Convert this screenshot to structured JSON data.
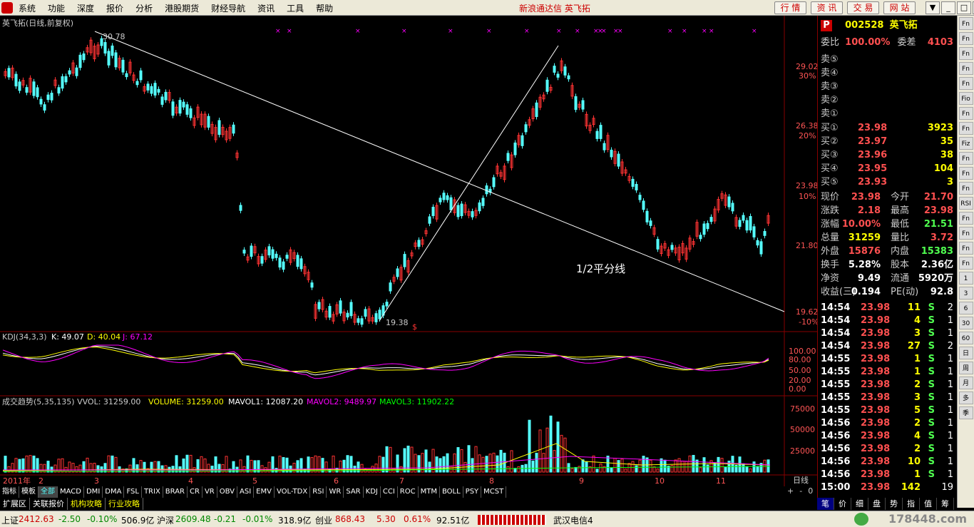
{
  "menubar": {
    "items": [
      "系统",
      "功能",
      "深度",
      "报价",
      "分析",
      "港股期货",
      "财经导航",
      "资讯",
      "工具",
      "帮助"
    ],
    "title": "新浪通达信  英飞拓",
    "buttons": [
      "行 情",
      "资 讯",
      "交 易",
      "网 站"
    ],
    "window_buttons": [
      "▼",
      "_",
      "□",
      "×"
    ]
  },
  "main_chart": {
    "title": "英飞拓(日线,前复权)",
    "high_label": "30.78",
    "low_label": "19.38",
    "annotation": "1/2平分线",
    "price_ticks": [
      "29.02",
      "26.38",
      "23.98",
      "21.80",
      "19.62"
    ],
    "pct_ticks": [
      "30%",
      "20%",
      "10%",
      "-10%"
    ],
    "months": [
      "2011年",
      "2",
      "3",
      "4",
      "5",
      "6",
      "7",
      "8",
      "9",
      "10",
      "11"
    ],
    "marker": "$"
  },
  "kdj": {
    "label": "KDJ(34,3,3)",
    "k": "K: 49.07",
    "d": "D: 40.04",
    "j": "J: 67.12",
    "ticks": [
      "100.00",
      "80.00",
      "50.00",
      "20.00",
      "0.00"
    ]
  },
  "vol": {
    "label": "成交趋势(5,35,135) VVOL: 31259.00",
    "volume": "VOLUME: 31259.00",
    "mavol1": "MAVOL1: 12087.20",
    "mavol2": "MAVOL2: 9489.97",
    "mavol3": "MAVOL3: 11902.22",
    "ticks": [
      "75000",
      "50000",
      "25000"
    ]
  },
  "period_label": "日线",
  "tabs": [
    "指标",
    "模板",
    "全部",
    "MACD",
    "DMI",
    "DMA",
    "FSL",
    "TRIX",
    "BRAR",
    "CR",
    "VR",
    "OBV",
    "ASI",
    "EMV",
    "VOL-TDX",
    "RSI",
    "WR",
    "SAR",
    "KDJ",
    "CCI",
    "ROC",
    "MTM",
    "BOLL",
    "PSY",
    "MCST"
  ],
  "subtabs": [
    "扩展区",
    "关联报价",
    "机构攻略",
    "行业攻略"
  ],
  "quote": {
    "logo": "P",
    "code": "002528",
    "name": "英飞拓",
    "weibi_label": "委比",
    "weibi": "100.00%",
    "weicha_label": "委差",
    "weicha": "4103",
    "sells": [
      "卖⑤",
      "卖④",
      "卖③",
      "卖②",
      "卖①"
    ],
    "buys": [
      {
        "l": "买①",
        "p": "23.98",
        "v": "3923"
      },
      {
        "l": "买②",
        "p": "23.97",
        "v": "35"
      },
      {
        "l": "买③",
        "p": "23.96",
        "v": "38"
      },
      {
        "l": "买④",
        "p": "23.95",
        "v": "104"
      },
      {
        "l": "买⑤",
        "p": "23.93",
        "v": "3"
      }
    ],
    "stats": [
      {
        "a": "现价",
        "b": "23.98",
        "c": "今开",
        "d": "21.70"
      },
      {
        "a": "涨跌",
        "b": "2.18",
        "c": "最高",
        "d": "23.98"
      },
      {
        "a": "涨幅",
        "b": "10.00%",
        "c": "最低",
        "d": "21.51"
      },
      {
        "a": "总量",
        "b": "31259",
        "c": "量比",
        "d": "3.72"
      },
      {
        "a": "外盘",
        "b": "15876",
        "c": "内盘",
        "d": "15383"
      },
      {
        "a": "换手",
        "b": "5.28%",
        "c": "股本",
        "d": "2.36亿"
      },
      {
        "a": "净资",
        "b": "9.49",
        "c": "流通",
        "d": "5920万"
      },
      {
        "a": "收益(三)",
        "b": "0.194",
        "c": "PE(动)",
        "d": "92.8"
      }
    ],
    "ticks": [
      [
        "14:54",
        "23.98",
        "11",
        "S",
        "2"
      ],
      [
        "14:54",
        "23.98",
        "4",
        "S",
        "1"
      ],
      [
        "14:54",
        "23.98",
        "3",
        "S",
        "1"
      ],
      [
        "14:54",
        "23.98",
        "27",
        "S",
        "2"
      ],
      [
        "14:55",
        "23.98",
        "1",
        "S",
        "1"
      ],
      [
        "14:55",
        "23.98",
        "1",
        "S",
        "1"
      ],
      [
        "14:55",
        "23.98",
        "2",
        "S",
        "1"
      ],
      [
        "14:55",
        "23.98",
        "3",
        "S",
        "1"
      ],
      [
        "14:55",
        "23.98",
        "5",
        "S",
        "1"
      ],
      [
        "14:56",
        "23.98",
        "2",
        "S",
        "1"
      ],
      [
        "14:56",
        "23.98",
        "4",
        "S",
        "1"
      ],
      [
        "14:56",
        "23.98",
        "2",
        "S",
        "1"
      ],
      [
        "14:56",
        "23.98",
        "10",
        "S",
        "1"
      ],
      [
        "14:56",
        "23.98",
        "1",
        "S",
        "1"
      ],
      [
        "15:00",
        "23.98",
        "142",
        "",
        "19"
      ]
    ],
    "tabs": [
      "笔",
      "价",
      "细",
      "盘",
      "势",
      "指",
      "值",
      "筹"
    ]
  },
  "icons": [
    "Fn",
    "Fn",
    "Fn",
    "Fn",
    "Fn",
    "Fio",
    "Fn",
    "Fn",
    "Fiz",
    "Fn",
    "Fn",
    "Fn",
    "RSI",
    "Fn",
    "Fn",
    "Fn",
    "Fn",
    "1",
    "3",
    "6",
    "30",
    "60",
    "日",
    "周",
    "月",
    "多",
    "季"
  ],
  "status": {
    "sh_label": "上证",
    "sh": "2412.63",
    "sh_chg": "-2.50",
    "sh_pct": "-0.10%",
    "sh_amt": "506.9亿",
    "sz_label": "沪深",
    "sz": "2609.48",
    "sz_chg": "-0.21",
    "sz_pct": "-0.01%",
    "sz_amt": "318.9亿",
    "cy_label": "创业",
    "cy": "868.43",
    "cy_chg": "5.30",
    "cy_pct": "0.61%",
    "cy_amt": "92.51亿",
    "server": "武汉电信4",
    "watermark": "178448.com"
  }
}
